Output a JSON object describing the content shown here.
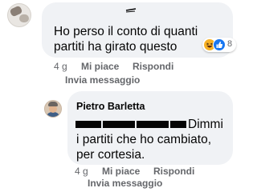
{
  "comment1": {
    "text_line1": "Ho perso il conto di quanti",
    "text_line2": "partiti ha girato questo",
    "reactions": {
      "icons": [
        "haha-icon",
        "like-icon"
      ],
      "count": "8"
    },
    "actions": {
      "time": "4 g",
      "like": "Mi piace",
      "reply": "Rispondi",
      "send": "Invia messaggio"
    }
  },
  "comment2": {
    "author": "Pietro Barletta",
    "text_line1": "Dimmi",
    "text_line2": "i partiti che ho cambiato,",
    "text_line3": "per cortesia.",
    "actions": {
      "time": "4 g",
      "like": "Mi piace",
      "reply": "Rispondi",
      "send": "Invia messaggio"
    }
  },
  "colors": {
    "bubble": "#f0f2f5",
    "meta_text": "#65676b",
    "text": "#050505",
    "like_blue": "#1877f2",
    "haha_yellow": "#f7b125"
  }
}
